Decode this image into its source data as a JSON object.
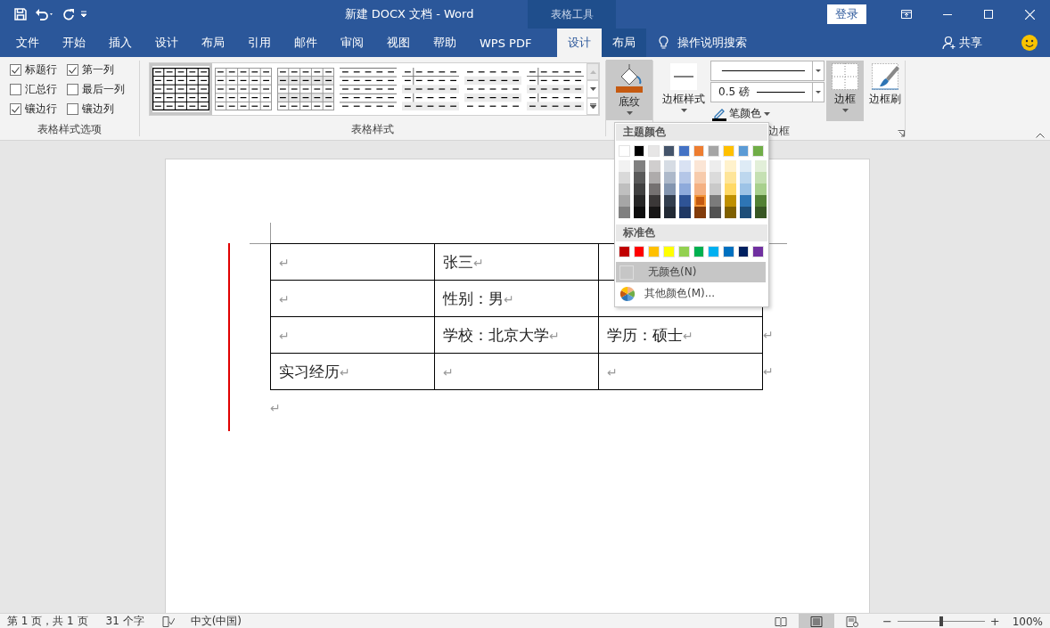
{
  "title_bar": {
    "quick_access": [
      {
        "kind": "save"
      },
      {
        "kind": "undo"
      },
      {
        "kind": "redo"
      },
      {
        "kind": "customize"
      }
    ],
    "title": "新建 DOCX 文档  -  Word",
    "context_label": "表格工具",
    "sign_in": "登录"
  },
  "tabs": [
    {
      "label": "文件",
      "kind": "normal",
      "selected": false
    },
    {
      "label": "开始",
      "kind": "normal",
      "selected": false
    },
    {
      "label": "插入",
      "kind": "normal",
      "selected": false
    },
    {
      "label": "设计",
      "kind": "normal",
      "selected": false
    },
    {
      "label": "布局",
      "kind": "normal",
      "selected": false
    },
    {
      "label": "引用",
      "kind": "normal",
      "selected": false
    },
    {
      "label": "邮件",
      "kind": "normal",
      "selected": false
    },
    {
      "label": "审阅",
      "kind": "normal",
      "selected": false
    },
    {
      "label": "视图",
      "kind": "normal",
      "selected": false
    },
    {
      "label": "帮助",
      "kind": "normal",
      "selected": false
    },
    {
      "label": "WPS PDF",
      "kind": "normal",
      "selected": false
    },
    {
      "label": "设计",
      "kind": "contextual",
      "selected": true
    },
    {
      "label": "布局",
      "kind": "contextual",
      "selected": false
    }
  ],
  "tell_me": "操作说明搜索",
  "share": "共享",
  "ribbon": {
    "style_options": {
      "label": "表格样式选项",
      "items": [
        {
          "label": "标题行",
          "checked": true
        },
        {
          "label": "第一列",
          "checked": true
        },
        {
          "label": "汇总行",
          "checked": false
        },
        {
          "label": "最后一列",
          "checked": false
        },
        {
          "label": "镶边行",
          "checked": true
        },
        {
          "label": "镶边列",
          "checked": false
        }
      ]
    },
    "styles": {
      "label": "表格样式",
      "gallery": [
        {
          "kind": "grid",
          "selected": true
        },
        {
          "kind": "light-grid",
          "selected": false
        },
        {
          "kind": "banded-grid",
          "selected": false
        },
        {
          "kind": "lines",
          "selected": false
        },
        {
          "kind": "first-column",
          "selected": false
        },
        {
          "kind": "banded-rows",
          "selected": false
        },
        {
          "kind": "first-column",
          "selected": false
        }
      ]
    },
    "shading": {
      "label": "底纹",
      "expanded": true
    },
    "borders": {
      "label": "边框",
      "style_button": "边框样式",
      "weight": "0.5 磅",
      "pen_color": "笔颜色",
      "border_button": {
        "label": "边框",
        "pressed": true
      },
      "painter": "边框刷"
    }
  },
  "shading_menu": {
    "theme_header": "主题颜色",
    "theme": [
      {
        "color": "#ffffff",
        "selected": false,
        "shades": [
          {
            "color": "#f2f2f2",
            "selected": false
          },
          {
            "color": "#d9d9d9",
            "selected": false
          },
          {
            "color": "#bfbfbf",
            "selected": false
          },
          {
            "color": "#a6a6a6",
            "selected": false
          },
          {
            "color": "#808080",
            "selected": false
          }
        ]
      },
      {
        "color": "#000000",
        "selected": false,
        "shades": [
          {
            "color": "#808080",
            "selected": false
          },
          {
            "color": "#595959",
            "selected": false
          },
          {
            "color": "#404040",
            "selected": false
          },
          {
            "color": "#262626",
            "selected": false
          },
          {
            "color": "#0d0d0d",
            "selected": false
          }
        ]
      },
      {
        "color": "#e7e6e6",
        "selected": false,
        "shades": [
          {
            "color": "#d0cece",
            "selected": false
          },
          {
            "color": "#aeabab",
            "selected": false
          },
          {
            "color": "#757171",
            "selected": false
          },
          {
            "color": "#3b3838",
            "selected": false
          },
          {
            "color": "#171616",
            "selected": false
          }
        ]
      },
      {
        "color": "#44546a",
        "selected": false,
        "shades": [
          {
            "color": "#d6dce4",
            "selected": false
          },
          {
            "color": "#adb9ca",
            "selected": false
          },
          {
            "color": "#8496b0",
            "selected": false
          },
          {
            "color": "#333f4f",
            "selected": false
          },
          {
            "color": "#222a35",
            "selected": false
          }
        ]
      },
      {
        "color": "#4472c4",
        "selected": false,
        "shades": [
          {
            "color": "#d9e2f3",
            "selected": false
          },
          {
            "color": "#b4c6e7",
            "selected": false
          },
          {
            "color": "#8eaadb",
            "selected": false
          },
          {
            "color": "#2f5496",
            "selected": false
          },
          {
            "color": "#1f3864",
            "selected": false
          }
        ]
      },
      {
        "color": "#ed7d31",
        "selected": false,
        "shades": [
          {
            "color": "#fbe5d5",
            "selected": false
          },
          {
            "color": "#f7cbac",
            "selected": false
          },
          {
            "color": "#f4b183",
            "selected": false
          },
          {
            "color": "#c55a11",
            "selected": true
          },
          {
            "color": "#833c0b",
            "selected": false
          }
        ]
      },
      {
        "color": "#a5a5a5",
        "selected": false,
        "shades": [
          {
            "color": "#ededed",
            "selected": false
          },
          {
            "color": "#dbdbdb",
            "selected": false
          },
          {
            "color": "#c9c9c9",
            "selected": false
          },
          {
            "color": "#7b7b7b",
            "selected": false
          },
          {
            "color": "#525252",
            "selected": false
          }
        ]
      },
      {
        "color": "#ffc000",
        "selected": false,
        "shades": [
          {
            "color": "#fff2cc",
            "selected": false
          },
          {
            "color": "#fee599",
            "selected": false
          },
          {
            "color": "#ffd965",
            "selected": false
          },
          {
            "color": "#bf9000",
            "selected": false
          },
          {
            "color": "#7f6000",
            "selected": false
          }
        ]
      },
      {
        "color": "#5b9bd5",
        "selected": false,
        "shades": [
          {
            "color": "#deebf6",
            "selected": false
          },
          {
            "color": "#bdd7ee",
            "selected": false
          },
          {
            "color": "#9dc3e6",
            "selected": false
          },
          {
            "color": "#2e75b5",
            "selected": false
          },
          {
            "color": "#1e4e79",
            "selected": false
          }
        ]
      },
      {
        "color": "#70ad47",
        "selected": false,
        "shades": [
          {
            "color": "#e2efd9",
            "selected": false
          },
          {
            "color": "#c5e0b3",
            "selected": false
          },
          {
            "color": "#a8d08d",
            "selected": false
          },
          {
            "color": "#538135",
            "selected": false
          },
          {
            "color": "#375623",
            "selected": false
          }
        ]
      }
    ],
    "standard_header": "标准色",
    "standard": [
      {
        "color": "#c00000",
        "selected": false
      },
      {
        "color": "#ff0000",
        "selected": false
      },
      {
        "color": "#ffc000",
        "selected": false
      },
      {
        "color": "#ffff00",
        "selected": false
      },
      {
        "color": "#92d050",
        "selected": false
      },
      {
        "color": "#00b050",
        "selected": false
      },
      {
        "color": "#00b0f0",
        "selected": false
      },
      {
        "color": "#0070c0",
        "selected": false
      },
      {
        "color": "#002060",
        "selected": false
      },
      {
        "color": "#7030a0",
        "selected": false
      }
    ],
    "no_color": {
      "label": "无颜色(N)",
      "selected": true
    },
    "more": "其他颜色(M)..."
  },
  "document": {
    "table": {
      "rows": [
        {
          "cells": [
            {
              "mark": "↵"
            },
            {
              "text": "张三",
              "mark": "↵"
            },
            {}
          ]
        },
        {
          "cells": [
            {
              "mark": "↵"
            },
            {
              "text": "性别：男",
              "mark": "↵"
            },
            {}
          ]
        },
        {
          "cells": [
            {
              "mark": "↵"
            },
            {
              "text": "学校：北京大学",
              "mark": "↵"
            },
            {
              "text": "学历：硕士",
              "mark": "↵"
            }
          ],
          "row_end": "↵"
        },
        {
          "cells": [
            {
              "text": "实习经历",
              "mark": "↵"
            },
            {
              "mark": "↵"
            },
            {
              "mark": "↵"
            }
          ],
          "row_end": "↵"
        }
      ]
    },
    "after_mark": "↵"
  },
  "status_bar": {
    "page": "第 1 页，共 1 页",
    "words": "31 个字",
    "language": "中文(中国)",
    "views": [
      {
        "kind": "read",
        "selected": false
      },
      {
        "kind": "print",
        "selected": true
      },
      {
        "kind": "web",
        "selected": false
      }
    ],
    "zoom": {
      "minus": "−",
      "plus": "+",
      "level": 0.5,
      "reading": "100%"
    }
  }
}
